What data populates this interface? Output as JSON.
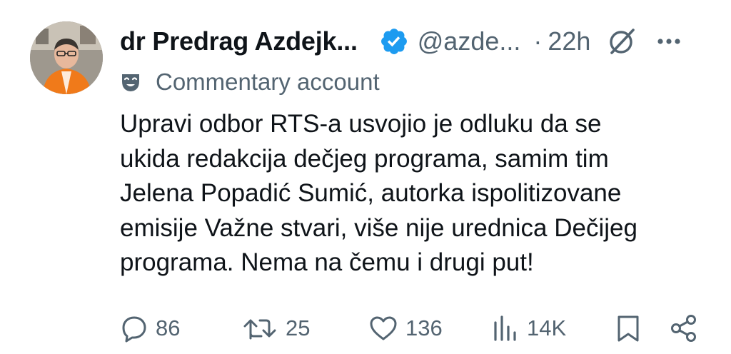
{
  "author": {
    "display_name": "dr Predrag Azdejk...",
    "handle": "@azde...",
    "separator": "·",
    "time": "22h",
    "verified": true
  },
  "label": {
    "icon": "theater-mask-icon",
    "text": "Commentary account"
  },
  "tweet": {
    "lines": [
      "Upravi odbor RTS-a usvojio je odluku da se",
      "ukida redakcija dečjeg programa, samim tim",
      "Jelena Popadić Sumić, autorka ispolitizovane",
      "emisije Važne stvari, više nije urednica Dečijeg",
      "programa. Nema na čemu i drugi put!"
    ]
  },
  "actions": {
    "reply_count": "86",
    "retweet_count": "25",
    "like_count": "136",
    "views_count": "14K"
  },
  "colors": {
    "text": "#0f1419",
    "secondary": "#536471",
    "verified": "#1d9bf0"
  }
}
